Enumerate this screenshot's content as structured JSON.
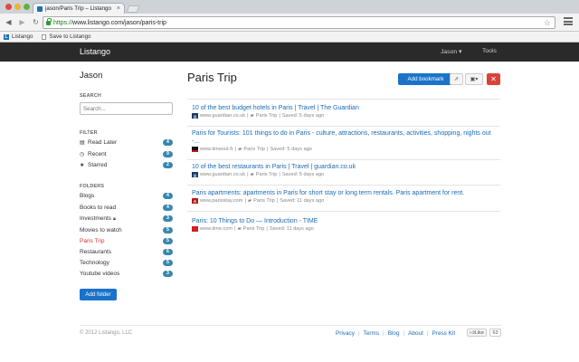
{
  "browser": {
    "tab_title": "jason/Paris Trip – Listango",
    "url_scheme": "https://",
    "url_rest": "www.listango.com/jason/paris-trip",
    "bookmarks_bar": [
      "Listango",
      "Save to Listango"
    ]
  },
  "navbar": {
    "brand": "Listango",
    "user_menu": "Jason ▾",
    "tools": "Tools"
  },
  "sidebar": {
    "user_name": "Jason",
    "search_label": "SEARCH",
    "search_placeholder": "Search...",
    "filter_label": "FILTER",
    "filters": [
      {
        "label": "Read Later",
        "count": "4",
        "icon": "book-icon"
      },
      {
        "label": "Recent",
        "count": "9",
        "icon": "clock-icon"
      },
      {
        "label": "Starred",
        "count": "2",
        "icon": "star-icon"
      }
    ],
    "folders_label": "FOLDERS",
    "folders": [
      {
        "label": "Blogs",
        "count": "4"
      },
      {
        "label": "Books to read",
        "count": "4"
      },
      {
        "label": "Investments",
        "count": "3",
        "locked": true
      },
      {
        "label": "Movies to watch",
        "count": "5"
      },
      {
        "label": "Paris Trip",
        "count": "5",
        "active": true
      },
      {
        "label": "Restaurants",
        "count": "6"
      },
      {
        "label": "Technology",
        "count": "5"
      },
      {
        "label": "Youtube videos",
        "count": "3"
      }
    ],
    "add_folder": "Add folder"
  },
  "main": {
    "title": "Paris Trip",
    "add_bookmark": "Add bookmark",
    "delete_symbol": "✕",
    "bookmarks": [
      {
        "title": "10 of the best budget hotels in Paris | Travel | The Guardian",
        "domain": "www.guardian.co.uk",
        "folder": "Paris Trip",
        "saved": "Saved: 5 days ago",
        "favicon_color": "#1b3d6e",
        "favicon_text": "g"
      },
      {
        "title": "Paris for Tourists: 101 things to do in Paris - culture, attractions, restaurants, activities, shopping, nights out -...",
        "domain": "www.timeout.fr",
        "folder": "Paris Trip",
        "saved": "Saved: 5 days ago",
        "favicon_color": "#c21a1a",
        "favicon_text": ""
      },
      {
        "title": "10 of the best restaurants in Paris | Travel | guardian.co.uk",
        "domain": "www.guardian.co.uk",
        "folder": "Paris Trip",
        "saved": "Saved: 5 days ago",
        "favicon_color": "#1b3d6e",
        "favicon_text": "g"
      },
      {
        "title": "Paris apartments: apartments in Paris for short stay or long term rentals. Paris apartment for rent.",
        "domain": "www.parisstay.com",
        "folder": "Paris Trip",
        "saved": "Saved: 11 days ago",
        "favicon_color": "#b51c1c",
        "favicon_text": "A"
      },
      {
        "title": "Paris: 10 Things to Do — Introduction - TIME",
        "domain": "www.time.com",
        "folder": "Paris Trip",
        "saved": "Saved: 11 days ago",
        "favicon_color": "#d41f1f",
        "favicon_text": ""
      }
    ]
  },
  "footer": {
    "copyright": "© 2012 Listango, LLC",
    "links": [
      "Privacy",
      "Terms",
      "Blog",
      "About",
      "Press Kit"
    ],
    "like_label": "Like",
    "like_count": "63"
  },
  "colors": {
    "accent": "#1a73c9",
    "active_folder": "#d33333",
    "badge": "#3a87ad",
    "delete": "#d9433a",
    "navbar": "#2a2a2a"
  }
}
